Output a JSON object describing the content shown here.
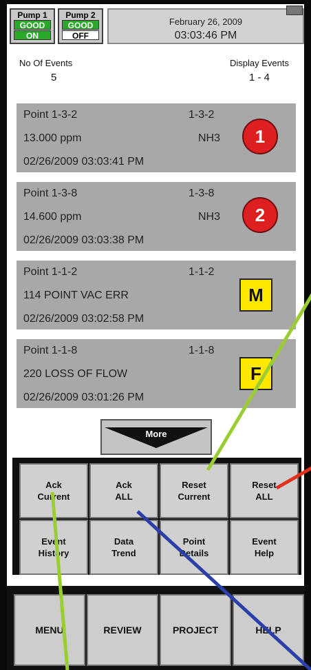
{
  "header": {
    "pumps": [
      {
        "name": "Pump 1",
        "status": "GOOD",
        "state": "ON"
      },
      {
        "name": "Pump 2",
        "status": "GOOD",
        "state": "OFF"
      }
    ],
    "date": "February 26, 2009",
    "time": "03:03:46 PM"
  },
  "events": {
    "count_label": "No Of Events",
    "count": "5",
    "display_label": "Display Events",
    "display_range": "1 - 4"
  },
  "cards": [
    {
      "point": "Point 1-3-2",
      "code": "1-3-2",
      "value": "13.000  ppm",
      "gas": "NH3",
      "timestamp": "02/26/2009 03:03:41 PM",
      "badge": "1"
    },
    {
      "point": "Point 1-3-8",
      "code": "1-3-8",
      "value": "14.600  ppm",
      "gas": "NH3",
      "timestamp": "02/26/2009 03:03:38 PM",
      "badge": "2"
    },
    {
      "point": "Point 1-1-2",
      "code": "1-1-2",
      "value": "114 POINT VAC ERR",
      "gas": "",
      "timestamp": "02/26/2009 03:02:58 PM",
      "badge": "M"
    },
    {
      "point": "Point 1-1-8",
      "code": "1-1-8",
      "value": "220 LOSS OF FLOW",
      "gas": "",
      "timestamp": "02/26/2009 03:01:26 PM",
      "badge": "F"
    }
  ],
  "more_label": "More",
  "actions": {
    "ack_current": "Ack\nCurrent",
    "ack_all": "Ack\nALL",
    "reset_current": "Reset\nCurrent",
    "reset_all": "Reset\nALL",
    "event_history": "Event\nHistory",
    "data_trend": "Data\nTrend",
    "point_details": "Point\nDetails",
    "event_help": "Event\nHelp"
  },
  "nav": {
    "menu": "MENU",
    "review": "REVIEW",
    "project": "PROJECT",
    "help": "HELP"
  },
  "colors": {
    "alarm_red": "#dd1f1f",
    "fault_yellow": "#ffe800",
    "status_green": "#29a829",
    "card_gray": "#a8a8a8"
  }
}
